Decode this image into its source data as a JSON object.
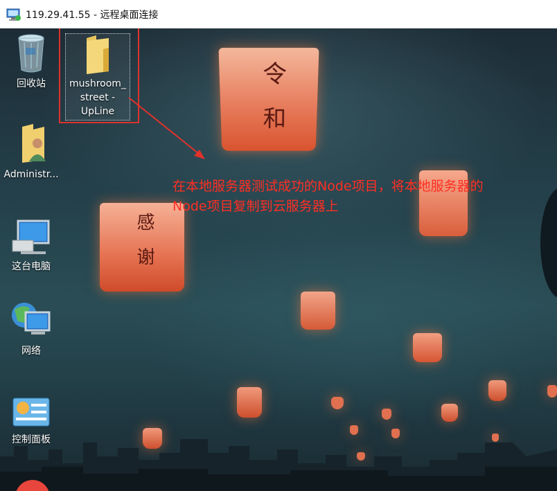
{
  "window": {
    "title": "119.29.41.55 - 远程桌面连接",
    "icon": "remote-desktop-icon"
  },
  "desktop": {
    "icons": [
      {
        "label": "回收站",
        "icon": "recycle-bin-icon"
      },
      {
        "label": "mushroom_\nstreet -\nUpLine",
        "icon": "folder-icon"
      },
      {
        "label": "Administr...",
        "icon": "user-folder-icon"
      },
      {
        "label": "这台电脑",
        "icon": "computer-icon"
      },
      {
        "label": "网络",
        "icon": "network-icon"
      },
      {
        "label": "控制面板",
        "icon": "control-panel-icon"
      }
    ],
    "annotation": {
      "line1": "在本地服务器测试成功的Node项目，将本地服务器的",
      "line2": "Node项目复制到云服务器上",
      "color": "#ff2e24"
    },
    "wallpaper": {
      "lantern_text_1": "令 和",
      "lantern_text_2": "感 谢"
    }
  }
}
